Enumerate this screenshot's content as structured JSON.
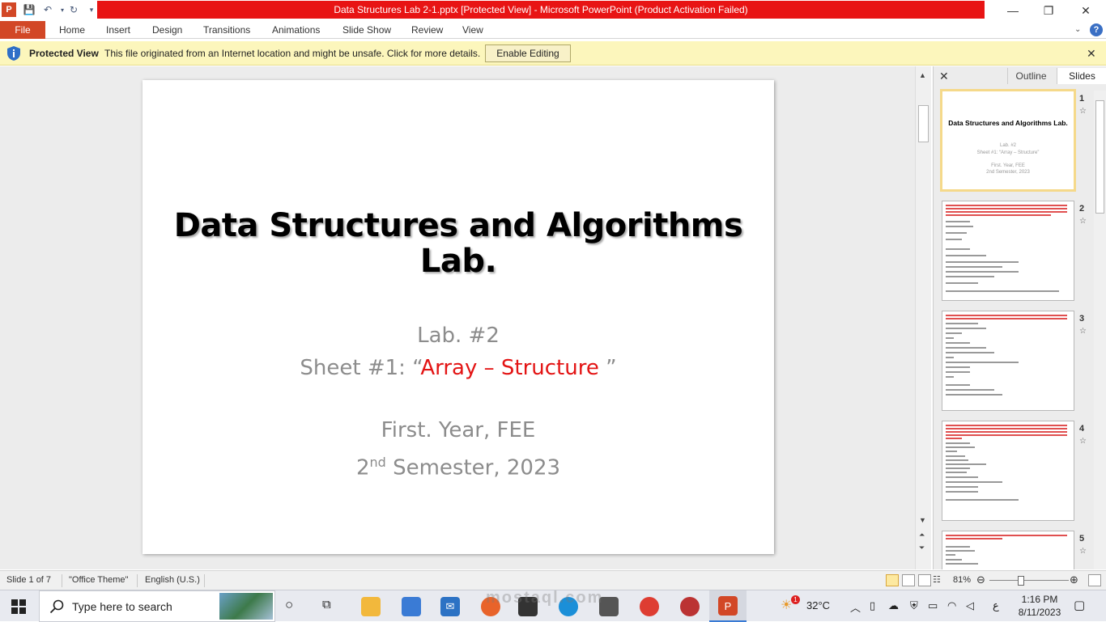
{
  "window": {
    "title": "Data Structures Lab 2-1.pptx [Protected View]  -  Microsoft PowerPoint (Product Activation Failed)",
    "minimize": "—",
    "restore": "❐",
    "close": "✕"
  },
  "ribbon": {
    "file": "File",
    "tabs": [
      "Home",
      "Insert",
      "Design",
      "Transitions",
      "Animations",
      "Slide Show",
      "Review",
      "View"
    ]
  },
  "protected": {
    "title": "Protected View",
    "message": "This file originated from an Internet location and might be unsafe. Click for more details.",
    "enable": "Enable Editing"
  },
  "slide": {
    "title_line1": "Data Structures and Algorithms",
    "title_line2": "Lab.",
    "lab": "Lab. #2",
    "sheet_prefix": "Sheet #1: “",
    "sheet_red": "Array – Structure",
    "sheet_suffix": " ”",
    "year": "First. Year, FEE",
    "sem_num": "2",
    "sem_sup": "nd",
    "sem_rest": " Semester, 2023"
  },
  "pane": {
    "outline": "Outline",
    "slides": "Slides",
    "thumbs": [
      {
        "num": "1",
        "title": "Data Structures and Algorithms Lab.",
        "sub1": "Lab. #2",
        "sub2": "Sheet #1: “Array – Structure”",
        "sub3": "First. Year, FEE",
        "sub4": "2nd Semester, 2023"
      },
      {
        "num": "2"
      },
      {
        "num": "3"
      },
      {
        "num": "4"
      },
      {
        "num": "5"
      }
    ]
  },
  "status": {
    "slide": "Slide 1 of 7",
    "theme": "\"Office Theme\"",
    "lang": "English (U.S.)",
    "zoom": "81%"
  },
  "taskbar": {
    "search": "Type here to search",
    "weather": "32°C",
    "weather_badge": "1",
    "lang": "ع",
    "time": "1:16 PM",
    "date": "8/11/2023"
  },
  "watermark": "mostaql.com"
}
